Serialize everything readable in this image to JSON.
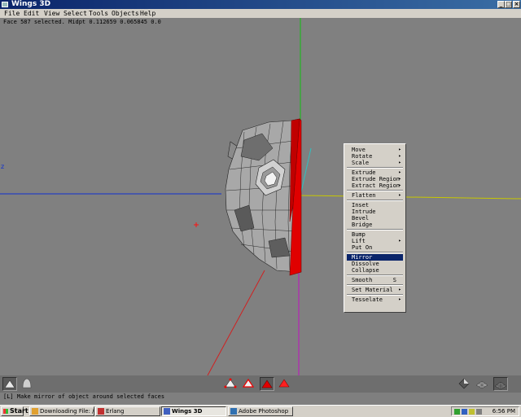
{
  "window": {
    "title": "Wings 3D",
    "controls": [
      "_",
      "□",
      "×"
    ]
  },
  "menubar": [
    "File",
    "Edit",
    "View",
    "Select",
    "Tools",
    "Objects",
    "Help"
  ],
  "viewport": {
    "status": "Face 587 selected. Midpt 0.112659 0.065845 0.0",
    "axis_labels": {
      "z": "z"
    }
  },
  "context_menu": {
    "items": [
      {
        "label": "Move",
        "submenu": true
      },
      {
        "label": "Rotate",
        "submenu": true
      },
      {
        "label": "Scale",
        "submenu": true
      },
      {
        "sep": true
      },
      {
        "label": "Extrude",
        "submenu": true
      },
      {
        "label": "Extrude Region",
        "submenu": true
      },
      {
        "label": "Extract Region",
        "submenu": true
      },
      {
        "sep": true
      },
      {
        "label": "Flatten",
        "submenu": true
      },
      {
        "sep": true
      },
      {
        "label": "Inset"
      },
      {
        "label": "Intrude"
      },
      {
        "label": "Bevel"
      },
      {
        "label": "Bridge"
      },
      {
        "sep": true
      },
      {
        "label": "Bump"
      },
      {
        "label": "Lift",
        "submenu": true
      },
      {
        "label": "Put On"
      },
      {
        "sep": true
      },
      {
        "label": "Mirror",
        "highlighted": true
      },
      {
        "label": "Dissolve"
      },
      {
        "label": "Collapse"
      },
      {
        "sep": true
      },
      {
        "label": "Smooth",
        "shortcut": "S"
      },
      {
        "sep": true
      },
      {
        "label": "Set Material",
        "submenu": true
      },
      {
        "sep": true
      },
      {
        "label": "Tesselate",
        "submenu": true
      }
    ]
  },
  "toolbar": {
    "left": [
      "cube-icon",
      "sphere-icon"
    ],
    "selection_modes": [
      "vertex-mode-icon",
      "edge-mode-icon",
      "face-mode-icon",
      "body-mode-icon"
    ],
    "active_mode": "face-mode-icon",
    "right": [
      "shaded-view-icon",
      "wireframe-view-icon",
      "smooth-preview-icon"
    ]
  },
  "info": "[L] Make mirror of object around selected faces",
  "taskbar": {
    "start": "Start",
    "tasks": [
      {
        "label": "Downloading File: /wings/...",
        "active": false
      },
      {
        "label": "Erlang",
        "active": false
      },
      {
        "label": "Wings 3D",
        "active": true
      },
      {
        "label": "Adobe Photoshop",
        "active": false
      }
    ],
    "clock": "6:56 PM"
  },
  "colors": {
    "viewport_bg": "#808080",
    "selection_red": "#ff0000",
    "menu_highlight": "#0a246a"
  }
}
